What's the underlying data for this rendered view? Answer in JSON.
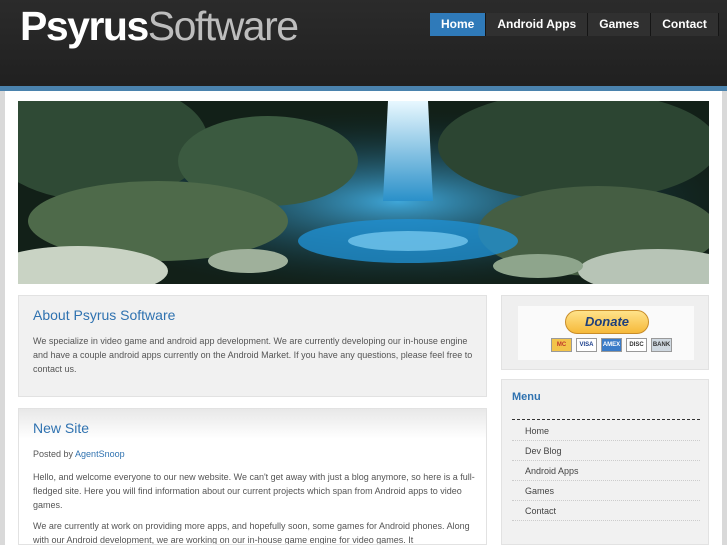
{
  "header": {
    "logo_part1": "Psyrus",
    "logo_part2": "Software",
    "nav": [
      "Home",
      "Android Apps",
      "Games",
      "Contact"
    ]
  },
  "about": {
    "title": "About Psyrus Software",
    "body": "We specialize in video game and android app development. We are currently developing our in-house engine and have a couple android apps currently on the Android Market. If you have any questions, please feel free to contact us."
  },
  "post": {
    "title": "New Site",
    "posted_by_label": "Posted by",
    "author": "AgentSnoop",
    "paragraph1": "Hello, and welcome everyone to our new website. We can't get away with just a blog anymore, so here is a full-fledged site. Here you will find information about our current projects which span from Android apps to video games.",
    "paragraph2": "We are currently at work on providing more apps, and hopefully soon, some games for Android phones. Along with our Android development, we are working on our in-house game engine for video games. It"
  },
  "donate": {
    "label": "Donate",
    "cards": [
      "MC",
      "VISA",
      "AMEX",
      "DISC",
      "BANK"
    ]
  },
  "sidebar": {
    "title": "Menu",
    "items": [
      "Home",
      "Dev Blog",
      "Android Apps",
      "Games",
      "Contact"
    ]
  },
  "colors": {
    "accent": "#2f7ab9",
    "link": "#2f72b0",
    "header_bg": "#262626"
  }
}
